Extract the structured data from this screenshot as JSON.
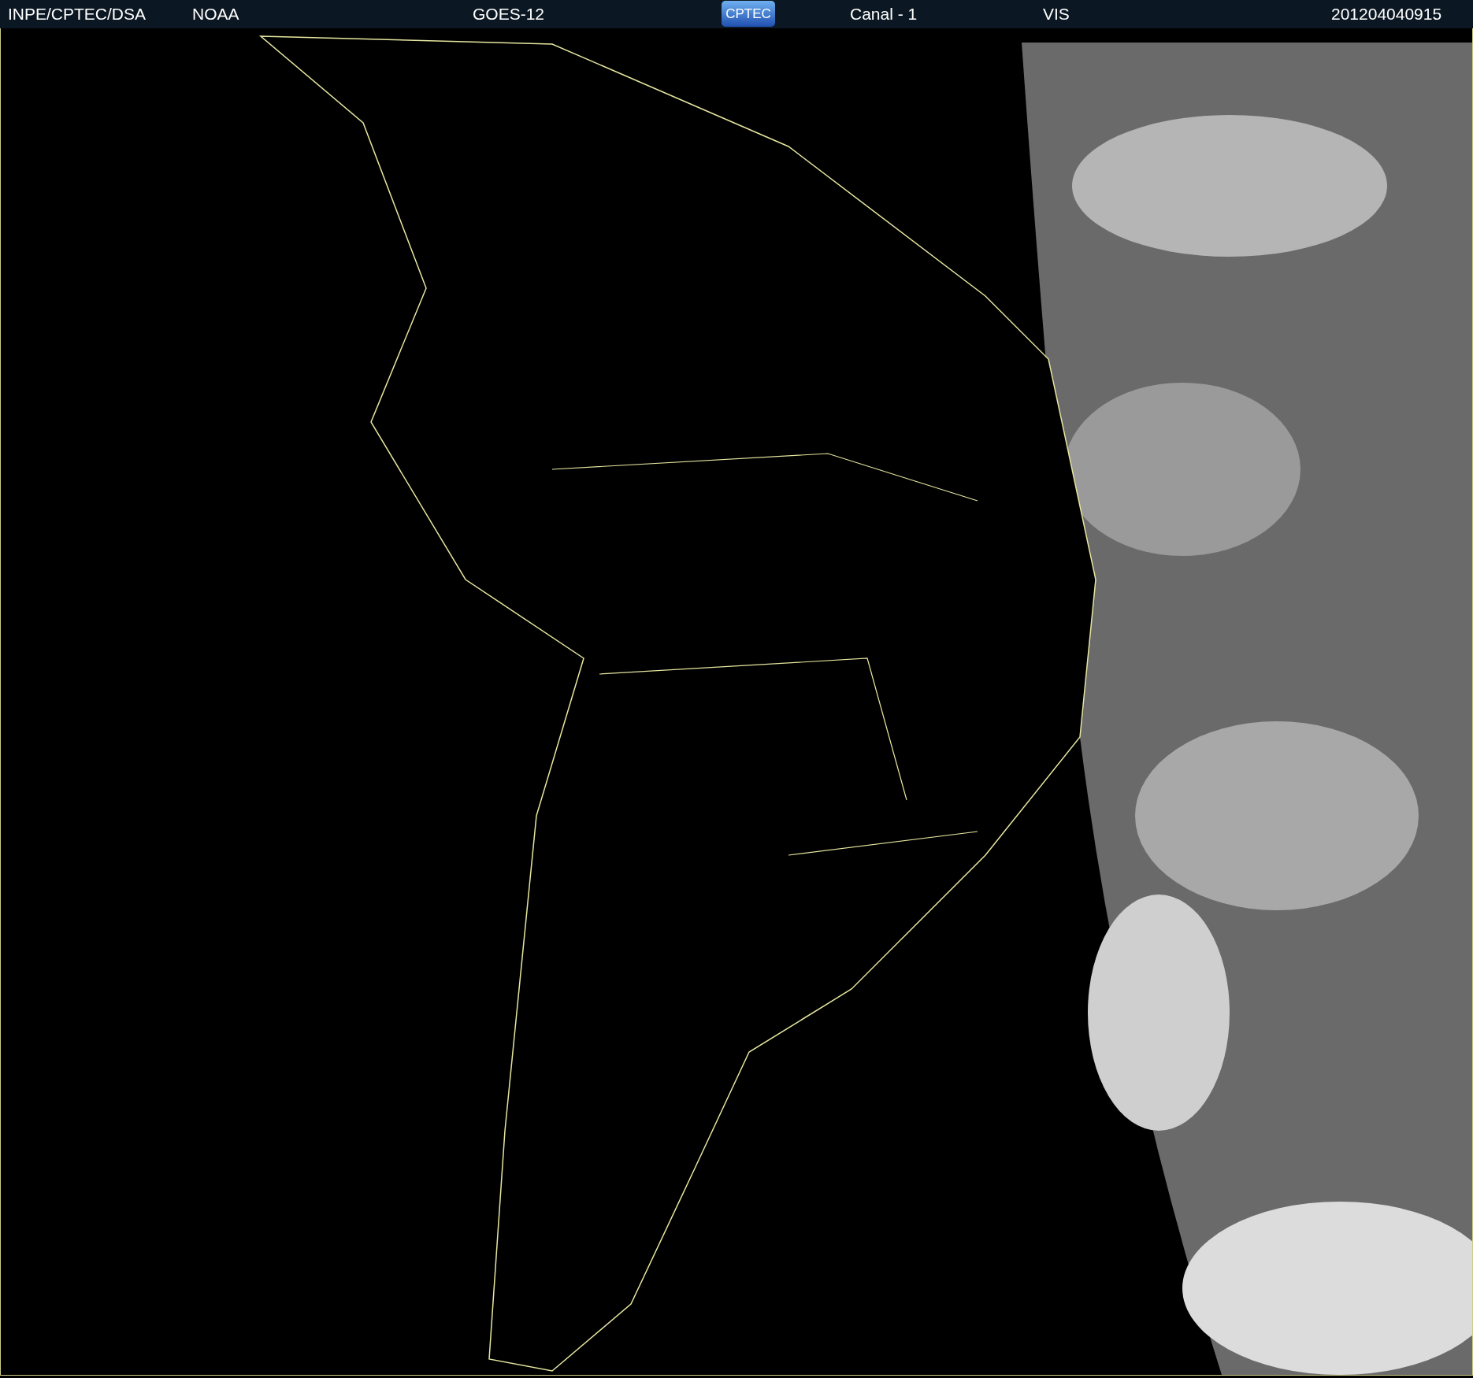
{
  "header": {
    "agency": "INPE/CPTEC/DSA",
    "source": "NOAA",
    "satellite": "GOES-12",
    "logo": "CPTEC",
    "channel": "Canal - 1",
    "band": "VIS",
    "timestamp": "201204040915"
  }
}
